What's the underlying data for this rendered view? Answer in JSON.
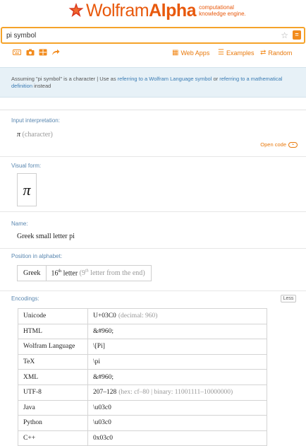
{
  "header": {
    "logo_main": "Wolfram",
    "logo_alpha": "Alpha",
    "tagline_line1": "computational",
    "tagline_line2": "knowledge engine."
  },
  "search": {
    "value": "pi symbol",
    "star_glyph": "☆",
    "equals_glyph": "="
  },
  "toolbar": {
    "icons": [
      "keyboard-icon",
      "camera-icon",
      "grid-icon",
      "share-icon"
    ],
    "web_apps": "Web Apps",
    "examples": "Examples",
    "random": "Random"
  },
  "assumption": {
    "prefix": "Assuming \"pi symbol\" is a character | Use as ",
    "link1": "referring to a Wolfram Language symbol",
    "middle": " or ",
    "link2": "referring to a mathematical definition",
    "suffix": " instead"
  },
  "pods": {
    "input": {
      "title": "Input interpretation:",
      "symbol": "π",
      "kind": "(character)",
      "open_code": "Open code"
    },
    "visual": {
      "title": "Visual form:",
      "glyph": "π"
    },
    "name": {
      "title": "Name:",
      "value": "Greek small letter pi"
    },
    "position": {
      "title": "Position in alphabet:",
      "alphabet": "Greek",
      "pos_num": "16",
      "pos_suffix": "th",
      "pos_word": "letter",
      "from_end_num": "9",
      "from_end_suffix": "th",
      "from_end_text": "letter from the end"
    },
    "encodings": {
      "title": "Encodings:",
      "less": "Less",
      "rows": [
        {
          "k": "Unicode",
          "v": "U+03C0",
          "x": "(decimal: 960)"
        },
        {
          "k": "HTML",
          "v": "&#960;",
          "x": ""
        },
        {
          "k": "Wolfram Language",
          "v": "\\[Pi]",
          "x": ""
        },
        {
          "k": "TeX",
          "v": "\\pi",
          "x": ""
        },
        {
          "k": "XML",
          "v": "&#960;",
          "x": ""
        },
        {
          "k": "UTF-8",
          "v": "207–128",
          "x": "(hex: cf–80 | binary: 11001111–10000000)"
        },
        {
          "k": "Java",
          "v": "\\u03c0",
          "x": ""
        },
        {
          "k": "Python",
          "v": "\\u03c0",
          "x": ""
        },
        {
          "k": "C++",
          "v": "0x03c0",
          "x": ""
        }
      ]
    }
  },
  "colors": {
    "brand": "#e8590c",
    "accent": "#f28b1d",
    "link": "#3a7bb3",
    "pod_title": "#5a87b0"
  }
}
